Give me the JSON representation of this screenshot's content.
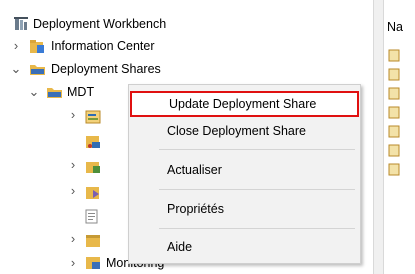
{
  "tree": {
    "root_label": "Deployment Workbench",
    "items": [
      {
        "label": "Information Center"
      },
      {
        "label": "Deployment Shares"
      },
      {
        "label": "MDT"
      },
      {
        "label": "Monitoring"
      }
    ]
  },
  "right_pane": {
    "header": "Na"
  },
  "context_menu": {
    "items": [
      {
        "label": "Update Deployment Share"
      },
      {
        "label": "Close Deployment Share"
      },
      {
        "label": "Actualiser"
      },
      {
        "label": "Propriétés"
      },
      {
        "label": "Aide"
      }
    ]
  },
  "colors": {
    "highlight_border": "#e01010",
    "folder_yellow": "#e8b84a"
  }
}
